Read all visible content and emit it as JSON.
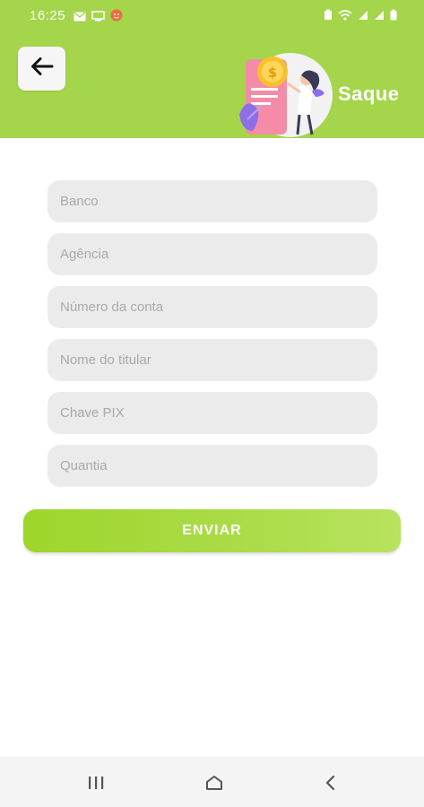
{
  "status_bar": {
    "time": "16:25",
    "left_icons": [
      "mail-icon",
      "screen-icon",
      "notification-face-icon"
    ],
    "right_icons": [
      "battery-saver-icon",
      "wifi-icon",
      "signal-icon",
      "signal-icon",
      "battery-icon"
    ]
  },
  "header": {
    "title": "Saque",
    "back_icon": "arrow-left-icon",
    "illustration": "payment-woman-coin-illustration"
  },
  "form": {
    "fields": [
      {
        "placeholder": "Banco",
        "value": ""
      },
      {
        "placeholder": "Agência",
        "value": ""
      },
      {
        "placeholder": "Número da conta",
        "value": ""
      },
      {
        "placeholder": "Nome do titular",
        "value": ""
      },
      {
        "placeholder": "Chave PIX",
        "value": ""
      },
      {
        "placeholder": "Quantia",
        "value": ""
      }
    ],
    "submit_label": "ENVIAR"
  },
  "colors": {
    "header": "#a4d54a",
    "button_start": "#9ed62b",
    "button_end": "#b8e35e",
    "field_bg": "#ebebeb",
    "placeholder": "#a9a9a9"
  },
  "navbar": {
    "items": [
      "recent-apps-icon",
      "home-icon",
      "back-icon"
    ]
  }
}
